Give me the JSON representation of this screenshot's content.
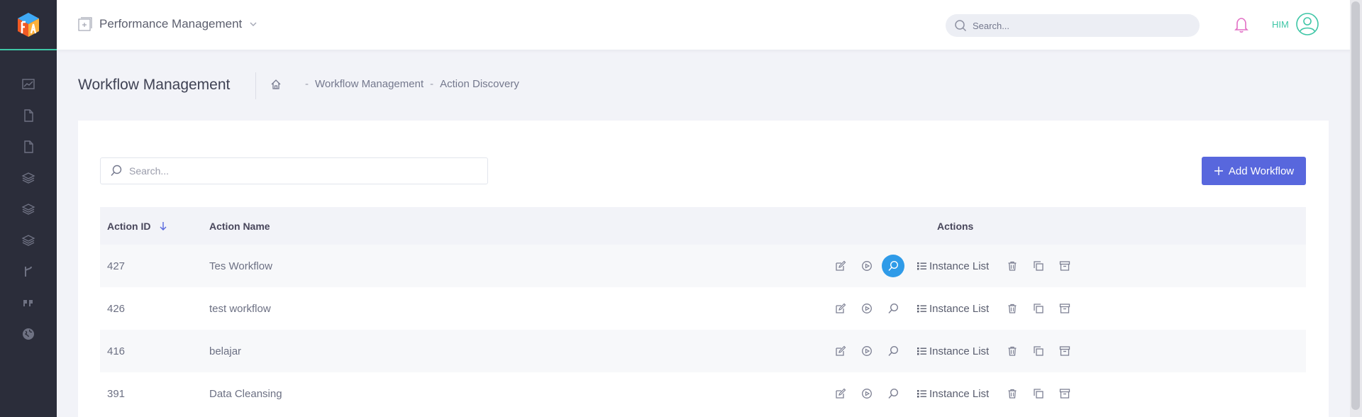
{
  "header": {
    "module_title": "Performance Management",
    "search_placeholder": "Search...",
    "user_name": "HIM"
  },
  "subheader": {
    "page_title": "Workflow Management",
    "breadcrumb": [
      "Workflow Management",
      "Action Discovery"
    ]
  },
  "card": {
    "search_placeholder": "Search...",
    "add_button_label": "Add Workflow"
  },
  "table": {
    "columns": {
      "id": "Action ID",
      "name": "Action Name",
      "actions": "Actions"
    },
    "instance_list_label": "Instance List",
    "rows": [
      {
        "id": "427",
        "name": "Tes Workflow"
      },
      {
        "id": "426",
        "name": "test workflow"
      },
      {
        "id": "416",
        "name": "belajar"
      },
      {
        "id": "391",
        "name": "Data Cleansing"
      }
    ]
  },
  "sidebar": {
    "icons": [
      "chart-line-icon",
      "document-icon",
      "document-icon",
      "layers-icon",
      "layers-icon",
      "layers-icon",
      "git-branch-icon",
      "quote-icon",
      "globe-icon"
    ]
  },
  "colors": {
    "sidebar_bg": "#2b2d3a",
    "accent_green": "#3ec6a6",
    "primary_button": "#5867dd",
    "active_action": "#2f9be8",
    "bell": "#e26fc5"
  }
}
